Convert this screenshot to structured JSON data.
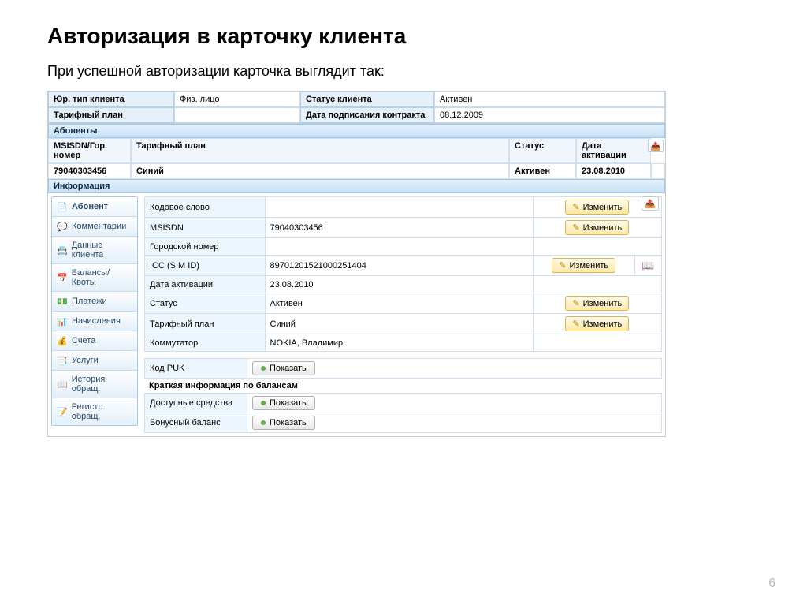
{
  "slide": {
    "title": "Авторизация в карточку клиента",
    "subtitle": "При успешной авторизации карточка выглядит так:",
    "page_number": "6"
  },
  "header": {
    "client_type_label": "Юр. тип клиента",
    "client_type_value": "Физ. лицо",
    "client_status_label": "Статус клиента",
    "client_status_value": "Активен",
    "tariff_label": "Тарифный план",
    "tariff_value": "",
    "contract_date_label": "Дата подписания контракта",
    "contract_date_value": "08.12.2009"
  },
  "subscribers": {
    "section_title": "Абоненты",
    "columns": {
      "msisdn": "MSISDN/Гор. номер",
      "tariff": "Тарифный план",
      "status": "Статус",
      "activation": "Дата активации"
    },
    "row": {
      "msisdn": "79040303456",
      "tariff": "Синий",
      "status": "Активен",
      "activation": "23.08.2010"
    },
    "export_icon": "export-icon"
  },
  "info_section": {
    "title": "Информация"
  },
  "sidebar": {
    "items": [
      {
        "label": "Абонент",
        "icon": "📄",
        "name": "sidebar-item-subscriber",
        "active": true
      },
      {
        "label": "Комментарии",
        "icon": "💬",
        "name": "sidebar-item-comments"
      },
      {
        "label": "Данные клиента",
        "icon": "📇",
        "name": "sidebar-item-client-data"
      },
      {
        "label": "Балансы/Квоты",
        "icon": "📅",
        "name": "sidebar-item-balances"
      },
      {
        "label": "Платежи",
        "icon": "💵",
        "name": "sidebar-item-payments"
      },
      {
        "label": "Начисления",
        "icon": "📊",
        "name": "sidebar-item-charges"
      },
      {
        "label": "Счета",
        "icon": "💰",
        "name": "sidebar-item-bills"
      },
      {
        "label": "Услуги",
        "icon": "📑",
        "name": "sidebar-item-services"
      },
      {
        "label": "История обращ.",
        "icon": "📖",
        "name": "sidebar-item-history"
      },
      {
        "label": "Регистр. обращ.",
        "icon": "📝",
        "name": "sidebar-item-register"
      }
    ]
  },
  "details": {
    "rows": [
      {
        "k": "Кодовое слово",
        "v": "",
        "edit": true
      },
      {
        "k": "MSISDN",
        "v": "79040303456",
        "edit": true
      },
      {
        "k": "Городской номер",
        "v": "",
        "edit": false
      },
      {
        "k": "ICC (SIM ID)",
        "v": "89701201521000251404",
        "edit": true,
        "book": true
      },
      {
        "k": "Дата активации",
        "v": "23.08.2010",
        "edit": false
      },
      {
        "k": "Статус",
        "v": "Активен",
        "edit": true
      },
      {
        "k": "Тарифный план",
        "v": "Синий",
        "edit": true
      },
      {
        "k": "Коммутатор",
        "v": "NOKIA, Владимир",
        "edit": false
      }
    ],
    "edit_label": "Изменить",
    "puk_label": "Код PUK",
    "show_label": "Показать",
    "balance_section_title": "Краткая информация по балансам",
    "balance_rows": [
      {
        "k": "Доступные средства"
      },
      {
        "k": "Бонусный баланс"
      }
    ],
    "export_icon": "export-icon"
  }
}
